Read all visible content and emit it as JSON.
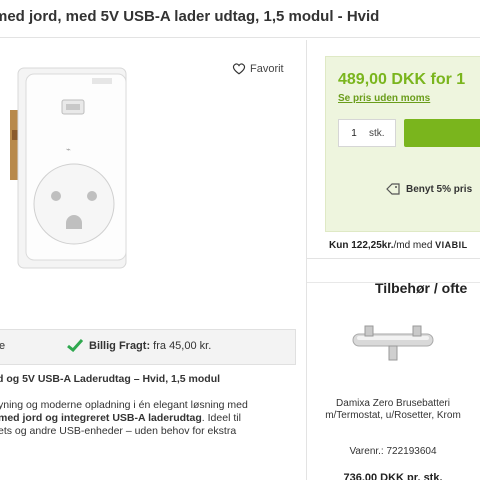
{
  "product": {
    "title": "med jord, med 5V USB-A lader udtag, 1,5 modul - Hvid",
    "favorite_label": "Favorit"
  },
  "freight": {
    "left_text": "e",
    "label": "Billig Fragt:",
    "value": "fra 45,00 kr."
  },
  "description": {
    "title": "d og 5V USB-A Laderudtag – Hvid, 1,5 modul",
    "line1": "yning og moderne opladning i én elegant løsning med",
    "line2_bold": "med jord og integreret USB-A laderudtag",
    "line2_rest": ". Ideel til",
    "line3": "ets og andre USB-enheder – uden behov for ekstra"
  },
  "pricing": {
    "price": "489,00 DKK for 1",
    "moms_link": "Se pris uden moms",
    "qty_value": "1",
    "qty_unit": "stk.",
    "promo_bold": "Benyt 5% pris",
    "monthly_prefix": "Kun 122,25kr.",
    "monthly_suffix": "/md med",
    "monthly_brand": "VIABIL"
  },
  "accessories": {
    "title": "Tilbehør / ofte",
    "item": {
      "name": "Damixa Zero Brusebatteri m/Termostat, u/Rosetter, Krom",
      "sku": "Varenr.: 722193604",
      "price": "736,00 DKK pr. stk."
    }
  },
  "colors": {
    "accent_green": "#7ab51d",
    "price_box_bg": "#eef5de"
  }
}
